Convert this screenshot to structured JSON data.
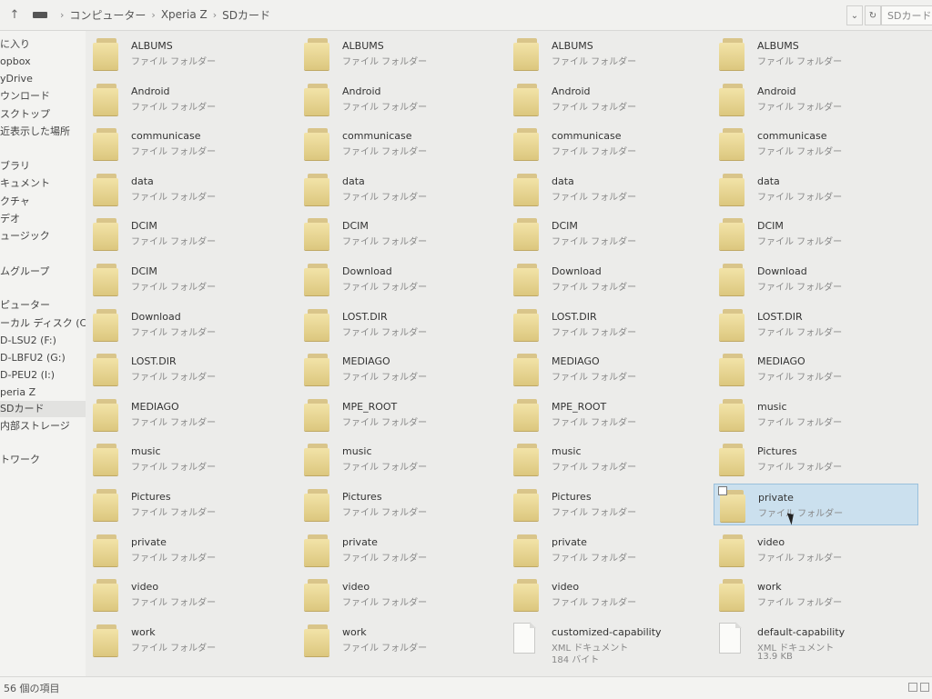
{
  "toolbar": {
    "up_glyph": "↑",
    "breadcrumb": [
      "コンピューター",
      "Xperia Z",
      "SDカード"
    ],
    "dropdown_glyph": "⌄",
    "refresh_glyph": "↻",
    "search_placeholder": "SDカード..."
  },
  "sidebar": {
    "items": [
      {
        "label": "に入り"
      },
      {
        "label": "opbox"
      },
      {
        "label": "yDrive"
      },
      {
        "label": "ウンロード"
      },
      {
        "label": "スクトップ"
      },
      {
        "label": "近表示した場所"
      },
      {
        "label": "ブラリ"
      },
      {
        "label": "キュメント"
      },
      {
        "label": "クチャ"
      },
      {
        "label": "デオ"
      },
      {
        "label": "ュージック"
      },
      {
        "label": "ムグループ"
      },
      {
        "label": "ピューター"
      },
      {
        "label": "ーカル ディスク (C:)"
      },
      {
        "label": "D-LSU2 (F:)"
      },
      {
        "label": "D-LBFU2 (G:)"
      },
      {
        "label": "D-PEU2 (I:)"
      },
      {
        "label": "peria Z"
      },
      {
        "label": "SDカード",
        "selected": true
      },
      {
        "label": "内部ストレージ"
      },
      {
        "label": "トワーク"
      }
    ]
  },
  "columns": [
    [
      {
        "name": "ALBUMS",
        "type": "ファイル フォルダー",
        "kind": "folder"
      },
      {
        "name": "Android",
        "type": "ファイル フォルダー",
        "kind": "folder"
      },
      {
        "name": "communicase",
        "type": "ファイル フォルダー",
        "kind": "folder"
      },
      {
        "name": "data",
        "type": "ファイル フォルダー",
        "kind": "folder"
      },
      {
        "name": "DCIM",
        "type": "ファイル フォルダー",
        "kind": "folder"
      },
      {
        "name": "DCIM",
        "type": "ファイル フォルダー",
        "kind": "folder"
      },
      {
        "name": "Download",
        "type": "ファイル フォルダー",
        "kind": "folder"
      },
      {
        "name": "LOST.DIR",
        "type": "ファイル フォルダー",
        "kind": "folder"
      },
      {
        "name": "MEDIAGO",
        "type": "ファイル フォルダー",
        "kind": "folder"
      },
      {
        "name": "music",
        "type": "ファイル フォルダー",
        "kind": "folder"
      },
      {
        "name": "Pictures",
        "type": "ファイル フォルダー",
        "kind": "folder"
      },
      {
        "name": "private",
        "type": "ファイル フォルダー",
        "kind": "folder"
      },
      {
        "name": "video",
        "type": "ファイル フォルダー",
        "kind": "folder"
      },
      {
        "name": "work",
        "type": "ファイル フォルダー",
        "kind": "folder"
      }
    ],
    [
      {
        "name": "ALBUMS",
        "type": "ファイル フォルダー",
        "kind": "folder"
      },
      {
        "name": "Android",
        "type": "ファイル フォルダー",
        "kind": "folder"
      },
      {
        "name": "communicase",
        "type": "ファイル フォルダー",
        "kind": "folder"
      },
      {
        "name": "data",
        "type": "ファイル フォルダー",
        "kind": "folder"
      },
      {
        "name": "DCIM",
        "type": "ファイル フォルダー",
        "kind": "folder"
      },
      {
        "name": "Download",
        "type": "ファイル フォルダー",
        "kind": "folder"
      },
      {
        "name": "LOST.DIR",
        "type": "ファイル フォルダー",
        "kind": "folder"
      },
      {
        "name": "MEDIAGO",
        "type": "ファイル フォルダー",
        "kind": "folder"
      },
      {
        "name": "MPE_ROOT",
        "type": "ファイル フォルダー",
        "kind": "folder"
      },
      {
        "name": "music",
        "type": "ファイル フォルダー",
        "kind": "folder"
      },
      {
        "name": "Pictures",
        "type": "ファイル フォルダー",
        "kind": "folder"
      },
      {
        "name": "private",
        "type": "ファイル フォルダー",
        "kind": "folder"
      },
      {
        "name": "video",
        "type": "ファイル フォルダー",
        "kind": "folder"
      },
      {
        "name": "work",
        "type": "ファイル フォルダー",
        "kind": "folder"
      }
    ],
    [
      {
        "name": "ALBUMS",
        "type": "ファイル フォルダー",
        "kind": "folder"
      },
      {
        "name": "Android",
        "type": "ファイル フォルダー",
        "kind": "folder"
      },
      {
        "name": "communicase",
        "type": "ファイル フォルダー",
        "kind": "folder"
      },
      {
        "name": "data",
        "type": "ファイル フォルダー",
        "kind": "folder"
      },
      {
        "name": "DCIM",
        "type": "ファイル フォルダー",
        "kind": "folder"
      },
      {
        "name": "Download",
        "type": "ファイル フォルダー",
        "kind": "folder"
      },
      {
        "name": "LOST.DIR",
        "type": "ファイル フォルダー",
        "kind": "folder"
      },
      {
        "name": "MEDIAGO",
        "type": "ファイル フォルダー",
        "kind": "folder"
      },
      {
        "name": "MPE_ROOT",
        "type": "ファイル フォルダー",
        "kind": "folder"
      },
      {
        "name": "music",
        "type": "ファイル フォルダー",
        "kind": "folder"
      },
      {
        "name": "Pictures",
        "type": "ファイル フォルダー",
        "kind": "folder"
      },
      {
        "name": "private",
        "type": "ファイル フォルダー",
        "kind": "folder"
      },
      {
        "name": "video",
        "type": "ファイル フォルダー",
        "kind": "folder"
      },
      {
        "name": "customized-capability",
        "type": "XML ドキュメント",
        "size": "184 バイト",
        "kind": "xml"
      }
    ],
    [
      {
        "name": "ALBUMS",
        "type": "ファイル フォルダー",
        "kind": "folder"
      },
      {
        "name": "Android",
        "type": "ファイル フォルダー",
        "kind": "folder"
      },
      {
        "name": "communicase",
        "type": "ファイル フォルダー",
        "kind": "folder"
      },
      {
        "name": "data",
        "type": "ファイル フォルダー",
        "kind": "folder"
      },
      {
        "name": "DCIM",
        "type": "ファイル フォルダー",
        "kind": "folder"
      },
      {
        "name": "Download",
        "type": "ファイル フォルダー",
        "kind": "folder"
      },
      {
        "name": "LOST.DIR",
        "type": "ファイル フォルダー",
        "kind": "folder"
      },
      {
        "name": "MEDIAGO",
        "type": "ファイル フォルダー",
        "kind": "folder"
      },
      {
        "name": "music",
        "type": "ファイル フォルダー",
        "kind": "folder"
      },
      {
        "name": "Pictures",
        "type": "ファイル フォルダー",
        "kind": "folder"
      },
      {
        "name": "private",
        "type": "ファイル フォルダー",
        "kind": "folder",
        "selected": true
      },
      {
        "name": "video",
        "type": "ファイル フォルダー",
        "kind": "folder"
      },
      {
        "name": "work",
        "type": "ファイル フォルダー",
        "kind": "folder"
      },
      {
        "name": "default-capability",
        "type": "XML ドキュメント",
        "size": "13.9 KB",
        "kind": "xml"
      }
    ]
  ],
  "statusbar": {
    "count": "56 個の項目"
  }
}
